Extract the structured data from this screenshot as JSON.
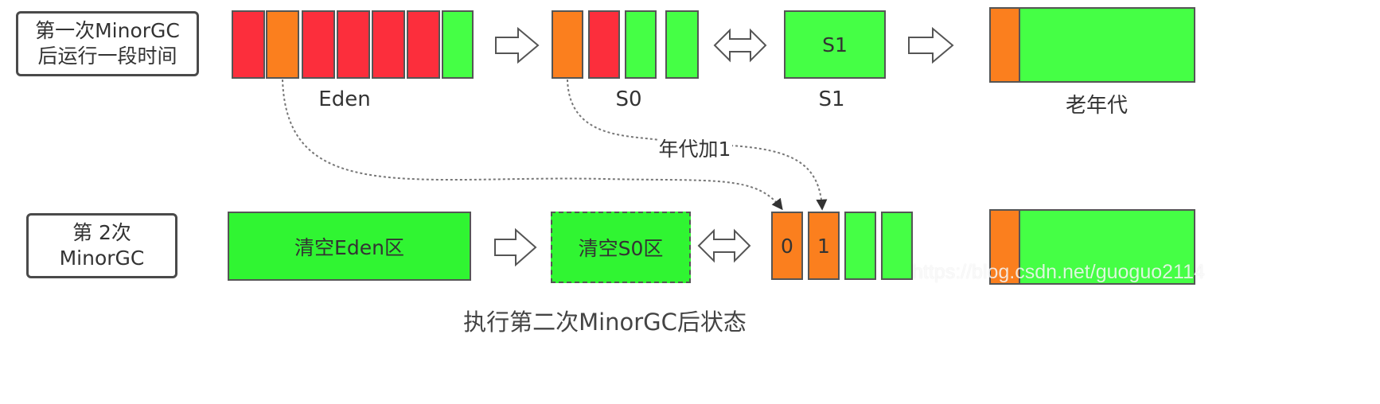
{
  "row1": {
    "stage_label": "第一次MinorGC\n后运行一段时间",
    "eden_label": "Eden",
    "s0_label": "S0",
    "s1_box_text": "S1",
    "s1_label": "S1",
    "old_label": "老年代"
  },
  "annotation": {
    "age_increment": "年代加1"
  },
  "row2": {
    "stage_label": "第 2次\nMinorGC",
    "eden_box_text": "清空Eden区",
    "s0_box_text": "清空S0区",
    "cell_0": "0",
    "cell_1": "1"
  },
  "caption": "执行第二次MinorGC后状态",
  "watermark": "https://blog.csdn.net/guoguo2114",
  "colors": {
    "surviving": "#fb7f1e",
    "garbage": "#fc2e3c",
    "free": "#45ff45",
    "cleared": "#30f532"
  }
}
